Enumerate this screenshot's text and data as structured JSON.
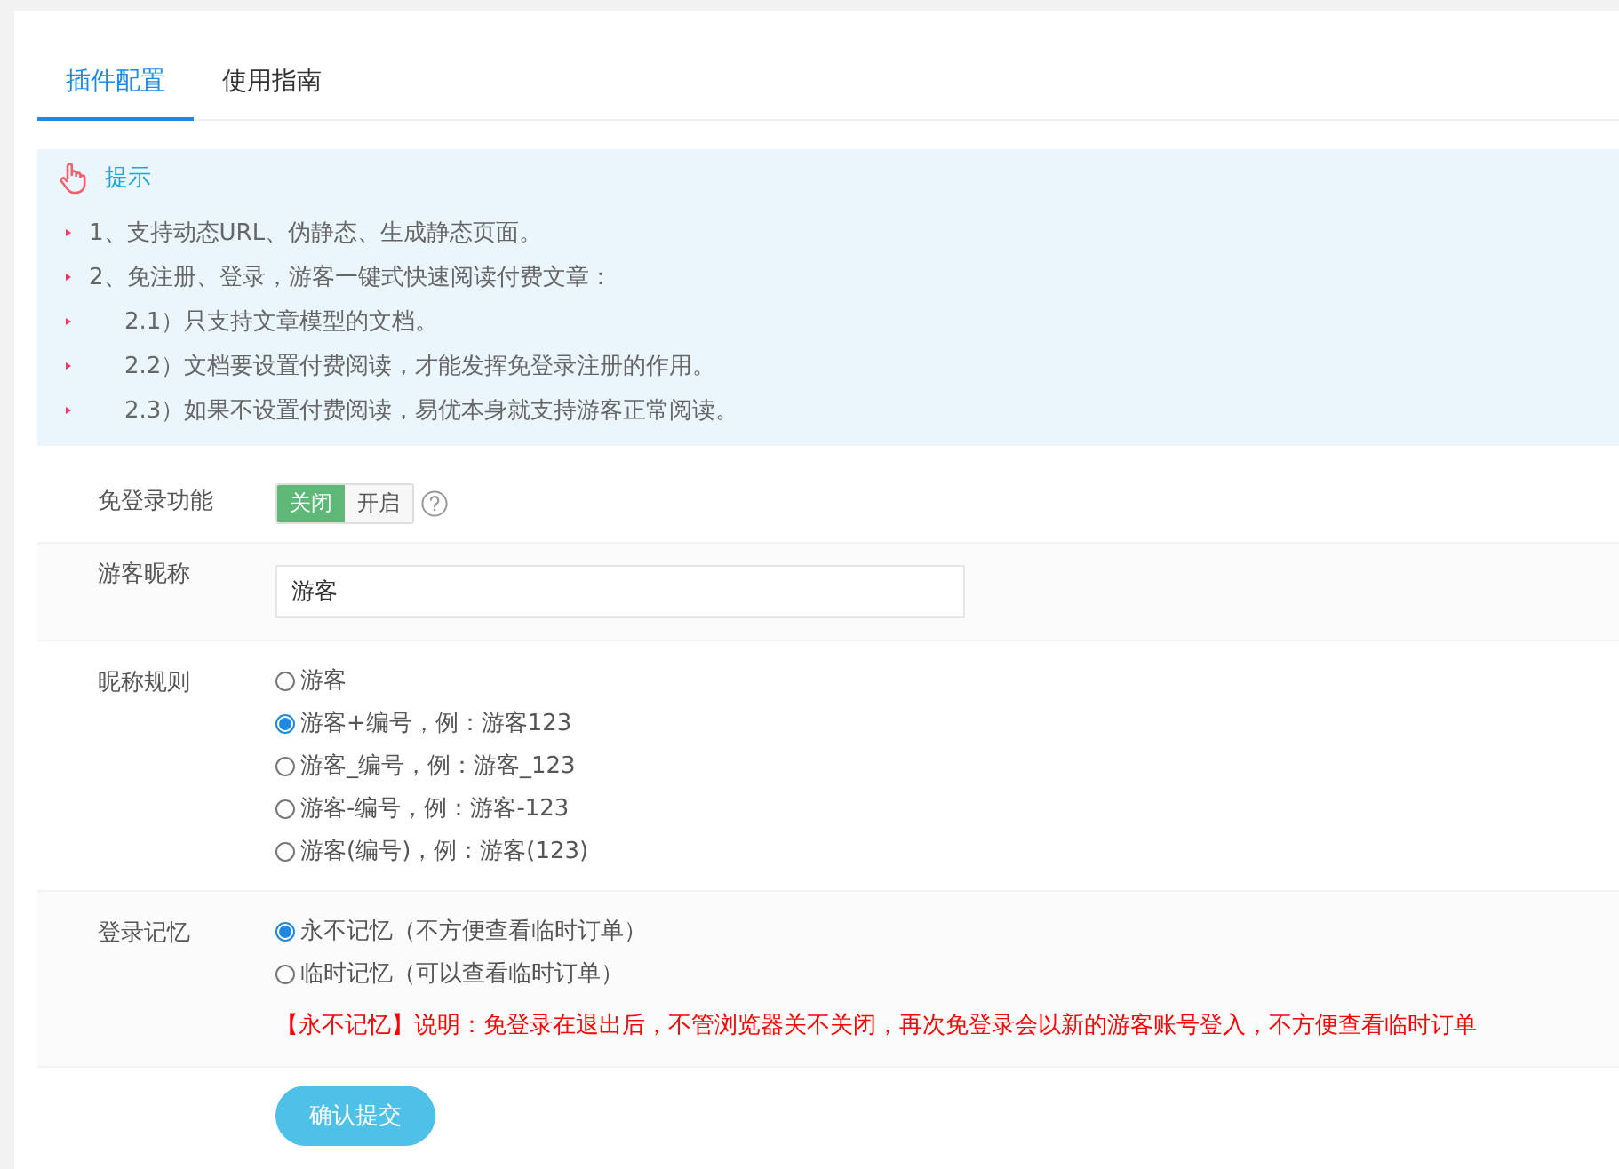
{
  "tabs": [
    {
      "label": "插件配置",
      "selected": true
    },
    {
      "label": "使用指南",
      "selected": false
    }
  ],
  "tip": {
    "title": "提示",
    "items": [
      {
        "text": "1、支持动态URL、伪静态、生成静态页面。"
      },
      {
        "text": "2、免注册、登录，游客一键式快速阅读付费文章：",
        "children": [
          {
            "text": "2.1）只支持文章模型的文档。"
          },
          {
            "text": "2.2）文档要设置付费阅读，才能发挥免登录注册的作用。"
          },
          {
            "text": "2.3）如果不设置付费阅读，易优本身就支持游客正常阅读。"
          }
        ]
      }
    ]
  },
  "rows": [
    {
      "kind": "toggle",
      "label": "免登录功能",
      "options": [
        {
          "label": "关闭",
          "selected": true
        },
        {
          "label": "开启",
          "selected": false
        }
      ]
    },
    {
      "kind": "text",
      "label": "游客昵称",
      "value": "游客"
    },
    {
      "kind": "radio",
      "label": "昵称规则",
      "options": [
        {
          "label": "游客",
          "selected": false
        },
        {
          "label": "游客+编号，例：游客123",
          "selected": true
        },
        {
          "label": "游客_编号，例：游客_123",
          "selected": false
        },
        {
          "label": "游客-编号，例：游客-123",
          "selected": false
        },
        {
          "label": "游客(编号)，例：游客(123)",
          "selected": false
        }
      ]
    },
    {
      "kind": "radio",
      "label": "登录记忆",
      "options": [
        {
          "label": "永不记忆（不方便查看临时订单）",
          "selected": true
        },
        {
          "label": "临时记忆（可以查看临时订单）",
          "selected": false
        }
      ],
      "note": "【永不记忆】说明：免登录在退出后，不管浏览器关不关闭，再次免登录会以新的游客账号登入，不方便查看临时订单"
    }
  ],
  "submit": "确认提交"
}
